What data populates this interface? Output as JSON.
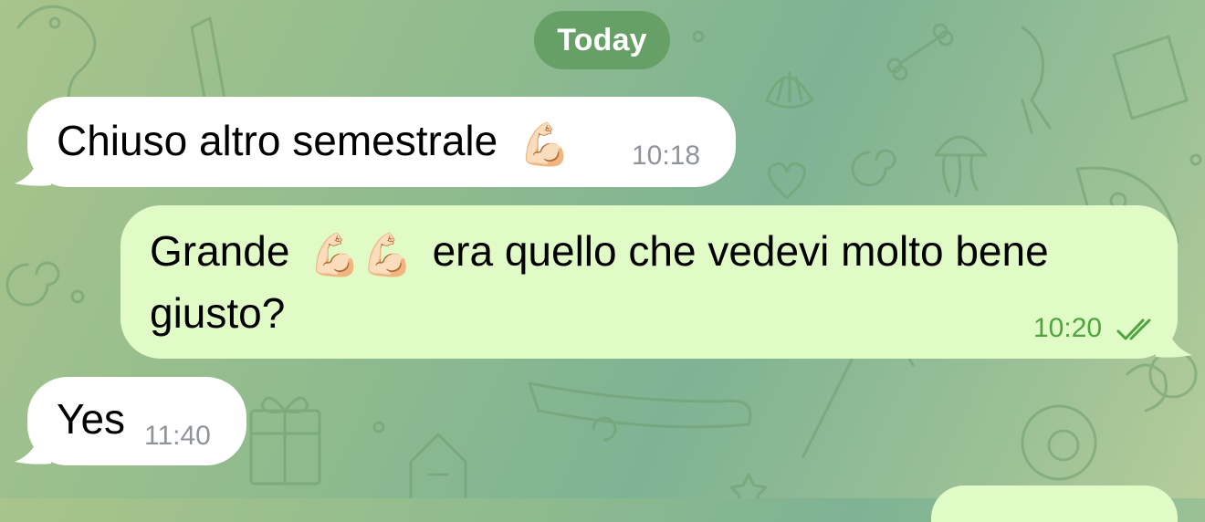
{
  "date_separator": "Today",
  "messages": [
    {
      "direction": "incoming",
      "text": "Chiuso altro semestrale",
      "emoji": "💪🏻",
      "time": "10:18"
    },
    {
      "direction": "outgoing",
      "text_before": "Grande",
      "emojis": "💪🏻💪🏻",
      "text_after": "era quello che vedevi molto bene",
      "line2": "giusto?",
      "time": "10:20",
      "status": "read"
    },
    {
      "direction": "incoming",
      "text": "Yes",
      "time": "11:40"
    }
  ],
  "colors": {
    "incoming_bubble": "#ffffff",
    "outgoing_bubble": "#e1fbc6",
    "outgoing_time": "#4ea43f",
    "incoming_time": "#8e9499",
    "date_pill": "#67a066"
  },
  "icons": [
    "flexed-biceps-emoji",
    "double-check-icon"
  ]
}
